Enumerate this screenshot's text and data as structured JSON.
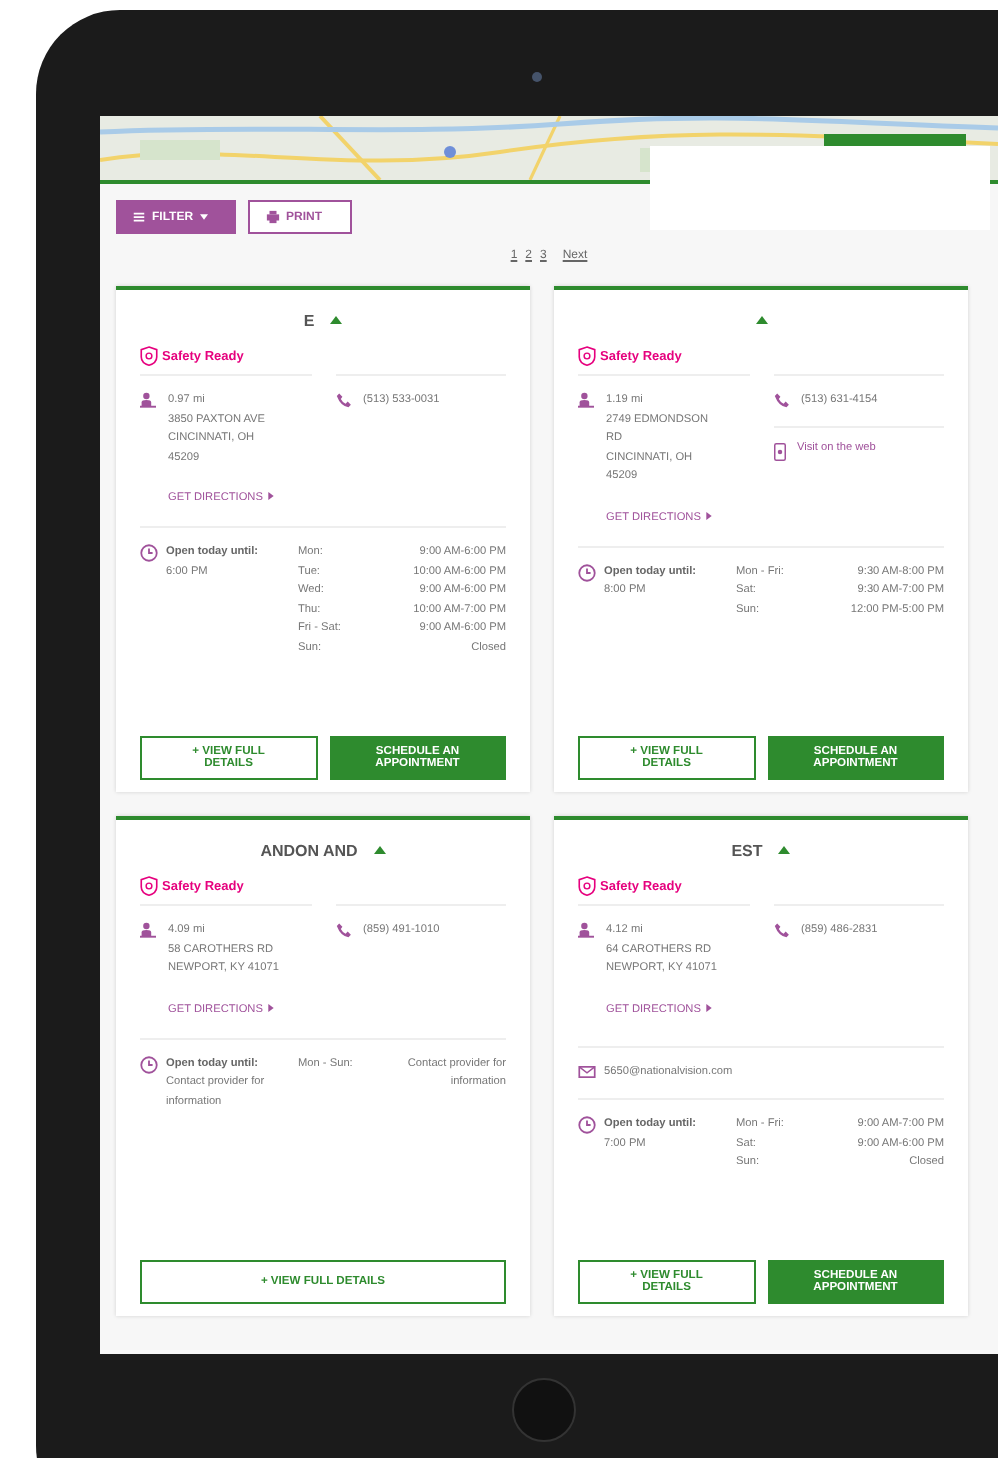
{
  "toolbar": {
    "filter_button": "FILTER",
    "print_button": "PRINT"
  },
  "pagination": [
    "1",
    "2",
    "3",
    "Next"
  ],
  "locations": [
    {
      "title": "E",
      "badge": "Safety Ready",
      "distance": "0.97 mi",
      "address": [
        "3850 PAXTON AVE",
        "CINCINNATI, OH 45209"
      ],
      "directions": "GET DIRECTIONS",
      "phone": "(513) 533-0031",
      "hours_label": "Open today until:",
      "hours_value": "6:00 PM",
      "schedule": [
        {
          "day": "Mon:",
          "hours": "9:00 AM-6:00 PM"
        },
        {
          "day": "Tue:",
          "hours": "10:00 AM-6:00 PM"
        },
        {
          "day": "Wed:",
          "hours": "9:00 AM-6:00 PM"
        },
        {
          "day": "Thu:",
          "hours": "10:00 AM-7:00 PM"
        },
        {
          "day": "Fri - Sat:",
          "hours": "9:00 AM-6:00 PM"
        },
        {
          "day": "Sun:",
          "hours": "Closed"
        }
      ],
      "buttons": [
        {
          "label": "+ VIEW FULL DETAILS",
          "kind": "outline"
        },
        {
          "label": "SCHEDULE AN APPOINTMENT",
          "kind": "primary"
        }
      ]
    },
    {
      "badge": "Safety Ready",
      "distance": "1.19 mi",
      "address": [
        "2749 EDMONDSON RD",
        "CINCINNATI, OH 45209"
      ],
      "directions": "GET DIRECTIONS",
      "phone": "(513) 631-4154",
      "website": "Visit on the web",
      "hours_label": "Open today until:",
      "hours_value": "8:00 PM",
      "schedule": [
        {
          "day": "Mon - Fri:",
          "hours": "9:30 AM-8:00 PM"
        },
        {
          "day": "Sat:",
          "hours": "9:30 AM-7:00 PM"
        },
        {
          "day": "Sun:",
          "hours": "12:00 PM-5:00 PM"
        }
      ],
      "buttons": [
        {
          "label": "+ VIEW FULL DETAILS",
          "kind": "outline"
        },
        {
          "label": "SCHEDULE AN APPOINTMENT",
          "kind": "primary"
        }
      ]
    },
    {
      "title": "ANDON AND",
      "badge": "Safety Ready",
      "distance": "4.09 mi",
      "address": [
        "58 CAROTHERS RD",
        "NEWPORT, KY 41071"
      ],
      "directions": "GET DIRECTIONS",
      "phone": "(859) 491-1010",
      "hours_label": "Open today until:",
      "hours_value": "Contact provider for information",
      "schedule": [
        {
          "day": "Mon - Sun:",
          "hours": "Contact provider for information"
        }
      ],
      "buttons": [
        {
          "label": "+ VIEW FULL DETAILS",
          "kind": "outline"
        }
      ]
    },
    {
      "title": "EST",
      "badge": "Safety Ready",
      "distance": "4.12 mi",
      "address": [
        "64 CAROTHERS RD",
        "NEWPORT, KY 41071"
      ],
      "directions": "GET DIRECTIONS",
      "phone": "(859) 486-2831",
      "email": "5650@nationalvision.com",
      "hours_label": "Open today until:",
      "hours_value": "7:00 PM",
      "schedule": [
        {
          "day": "Mon - Fri:",
          "hours": "9:00 AM-7:00 PM"
        },
        {
          "day": "Sat:",
          "hours": "9:00 AM-6:00 PM"
        },
        {
          "day": "Sun:",
          "hours": "Closed"
        }
      ],
      "buttons": [
        {
          "label": "+ VIEW FULL DETAILS",
          "kind": "outline"
        },
        {
          "label": "SCHEDULE AN APPOINTMENT",
          "kind": "primary"
        }
      ]
    }
  ]
}
